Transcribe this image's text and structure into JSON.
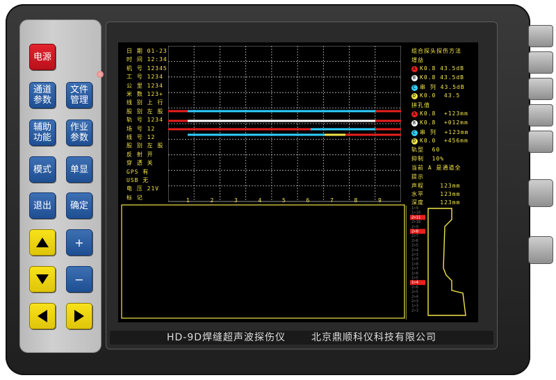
{
  "keys": {
    "power": "电源",
    "channel": "通道\n参数",
    "file": "文件\n管理",
    "aux": "辅助\n功能",
    "work": "作业\n参数",
    "mode": "模式",
    "single": "单显",
    "back": "退出",
    "ok": "确定",
    "plus": "+",
    "minus": "−"
  },
  "left_info": [
    "日 期 01-23",
    "时 间 12:34",
    "机 号 12345",
    "工 号 1234",
    "公 里 1234",
    "米 数 123+",
    "线 别 上 行",
    "股 别 左 股",
    "轨 号 1234",
    "场 号 12",
    "线 号 12",
    "股 别 左 股",
    "反 射 开",
    "穿 透 关",
    "GPS 有",
    "USB 无",
    "电 压 21V",
    "标 记"
  ],
  "x_ticks": [
    "1",
    "2",
    "3",
    "4",
    "5",
    "6",
    "7",
    "8",
    "9"
  ],
  "right_panel": {
    "title": "组合探头探伤方法",
    "gain_label": "增益",
    "gains": [
      {
        "badge": "A",
        "color": "#e8201e",
        "text": "K0.8 43.5dB"
      },
      {
        "badge": "B",
        "color": "#ffffff",
        "text": "K0.8 43.5dB"
      },
      {
        "badge": "C",
        "color": "#2fd0ff",
        "text": "串 列 43.5dB"
      },
      {
        "badge": "D",
        "color": "#f4e64a",
        "text": "K0.0  43.5"
      }
    ],
    "hole_label": "拼孔值",
    "holes": [
      {
        "badge": "A",
        "color": "#e8201e",
        "text": "K0.8  +123mm"
      },
      {
        "badge": "B",
        "color": "#ffffff",
        "text": "K0.8  +012mm"
      },
      {
        "badge": "C",
        "color": "#2fd0ff",
        "text": "串 列  +123mm"
      },
      {
        "badge": "D",
        "color": "#f4e64a",
        "text": "K0.0  +456mm"
      }
    ],
    "rail_type": "轨型  60",
    "suppress": "抑制  10%",
    "current": "当前 A 是通道全",
    "hint": "提示",
    "sound_path": "声程    123mm",
    "horizontal": "水平    123mm",
    "depth": "深度    123mm"
  },
  "ruler_labels": [
    "1>9",
    "1>10",
    "2>11",
    "2>10",
    "2>9",
    "2>8",
    "2>7",
    "2>6",
    "2>5",
    "2>4",
    "2>3",
    "1>9",
    "1>8",
    "1>7",
    "1>6",
    "1>5",
    "1>4",
    "2>6",
    "2>5",
    "2>4",
    "2>3",
    "1>3",
    "2>3"
  ],
  "ruler_highlight": [
    "2>11",
    "2>8",
    "1>4"
  ],
  "brand": {
    "model": "HD-9D焊缝超声波探伤仪",
    "company": "北京鼎顺科仪科技有限公司"
  },
  "colors": {
    "screen_fg": "#f4e64a",
    "red": "#e8201e",
    "cyan": "#2fd0ff",
    "white": "#ffffff"
  }
}
